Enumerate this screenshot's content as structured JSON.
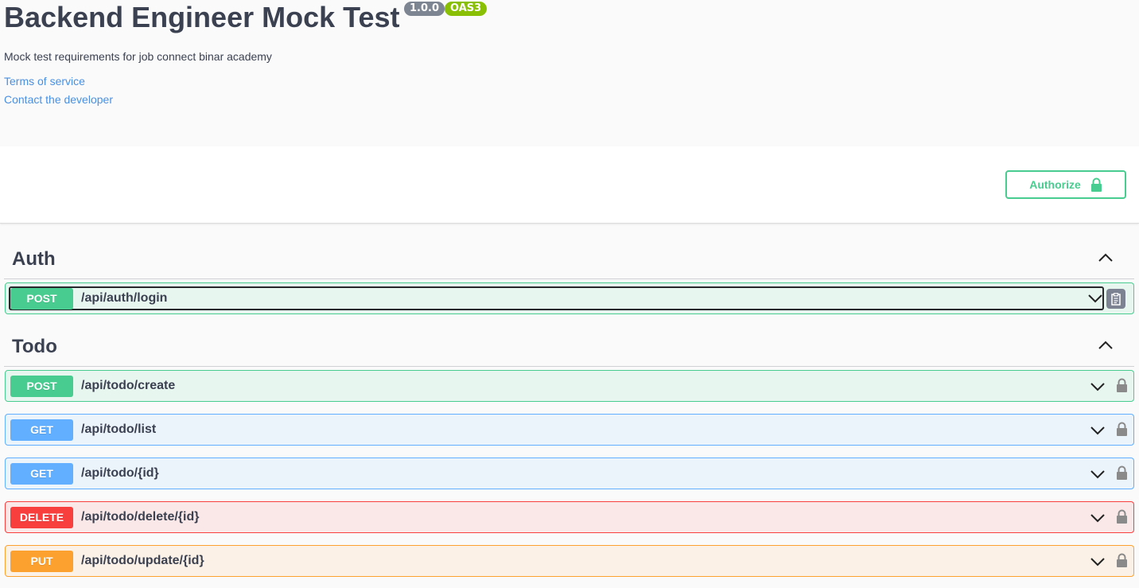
{
  "info": {
    "title": "Backend Engineer Mock Test",
    "version": "1.0.0",
    "oas": "OAS3",
    "description": "Mock test requirements for job connect binar academy",
    "terms_link": "Terms of service",
    "contact_link": "Contact the developer"
  },
  "scheme": {
    "authorize_label": "Authorize"
  },
  "colors": {
    "post": "#49cc90",
    "get": "#61affe",
    "delete": "#f93e3e",
    "put": "#fca130",
    "text": "#3b4151",
    "link": "#4990e2"
  },
  "sections": [
    {
      "name": "Auth",
      "operations": [
        {
          "method": "POST",
          "path": "/api/auth/login"
        }
      ]
    },
    {
      "name": "Todo",
      "operations": [
        {
          "method": "POST",
          "path": "/api/todo/create"
        },
        {
          "method": "GET",
          "path": "/api/todo/list"
        },
        {
          "method": "GET",
          "path": "/api/todo/{id}"
        },
        {
          "method": "DELETE",
          "path": "/api/todo/delete/{id}"
        },
        {
          "method": "PUT",
          "path": "/api/todo/update/{id}"
        }
      ]
    }
  ],
  "icons": [
    "lock-icon",
    "chevron-up-icon",
    "chevron-down-icon",
    "copy-icon"
  ]
}
